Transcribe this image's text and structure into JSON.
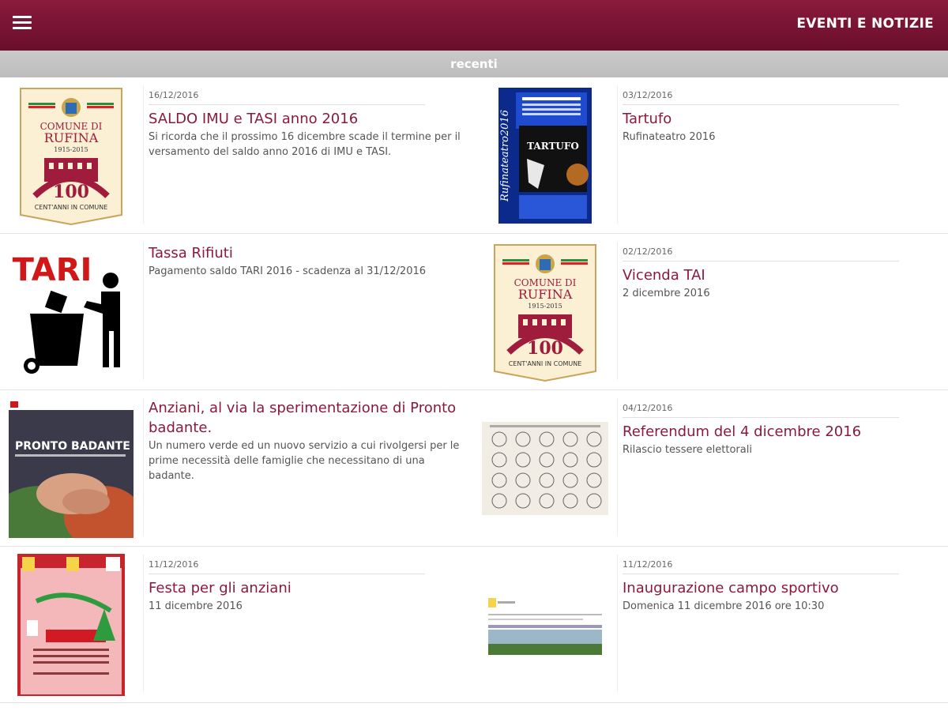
{
  "header": {
    "title": "EVENTI E NOTIZIE",
    "menu_icon": "hamburger-menu-icon"
  },
  "section": {
    "label": "recenti"
  },
  "colors": {
    "brand": "#7a1234",
    "title_text": "#8a1a3c",
    "subbar": "#c4c4c4"
  },
  "items": [
    {
      "date": "16/12/2016",
      "title": "SALDO IMU e TASI anno 2016",
      "desc": "Si ricorda che il prossimo 16 dicembre scade il termine per il versamento del saldo anno 2016 di IMU e TASI."
    },
    {
      "date": "03/12/2016",
      "title": "Tartufo",
      "desc": "Rufinateatro 2016"
    },
    {
      "date": "",
      "title": "Tassa Rifiuti",
      "desc": "Pagamento saldo TARI 2016 - scadenza al 31/12/2016"
    },
    {
      "date": "02/12/2016",
      "title": "Vicenda TAI",
      "desc": "2 dicembre 2016"
    },
    {
      "date": "",
      "title": "Anziani, al via la sperimentazione di Pronto badante.",
      "desc": "Un numero verde ed un nuovo servizio a cui rivolgersi per le prime necessità delle famiglie che necessitano di una badante."
    },
    {
      "date": "04/12/2016",
      "title": "Referendum del 4 dicembre 2016",
      "desc": "Rilascio tessere elettorali"
    },
    {
      "date": "11/12/2016",
      "title": "Festa per gli anziani",
      "desc": "11 dicembre 2016"
    },
    {
      "date": "11/12/2016",
      "title": "Inaugurazione campo sportivo",
      "desc": "Domenica 11 dicembre 2016 ore 10:30"
    }
  ],
  "logo": {
    "line1": "COMUNE DI",
    "line2": "RUFINA",
    "years": "1915-2015",
    "number": "100",
    "tagline": "CENT'ANNI IN COMUNE"
  },
  "tari_image": {
    "label": "TARI"
  },
  "badante_image": {
    "label": "PRONTO BADANTE"
  },
  "tartufo_image": {
    "label": "TARTUFO",
    "side": "Rufinateatro2016"
  }
}
